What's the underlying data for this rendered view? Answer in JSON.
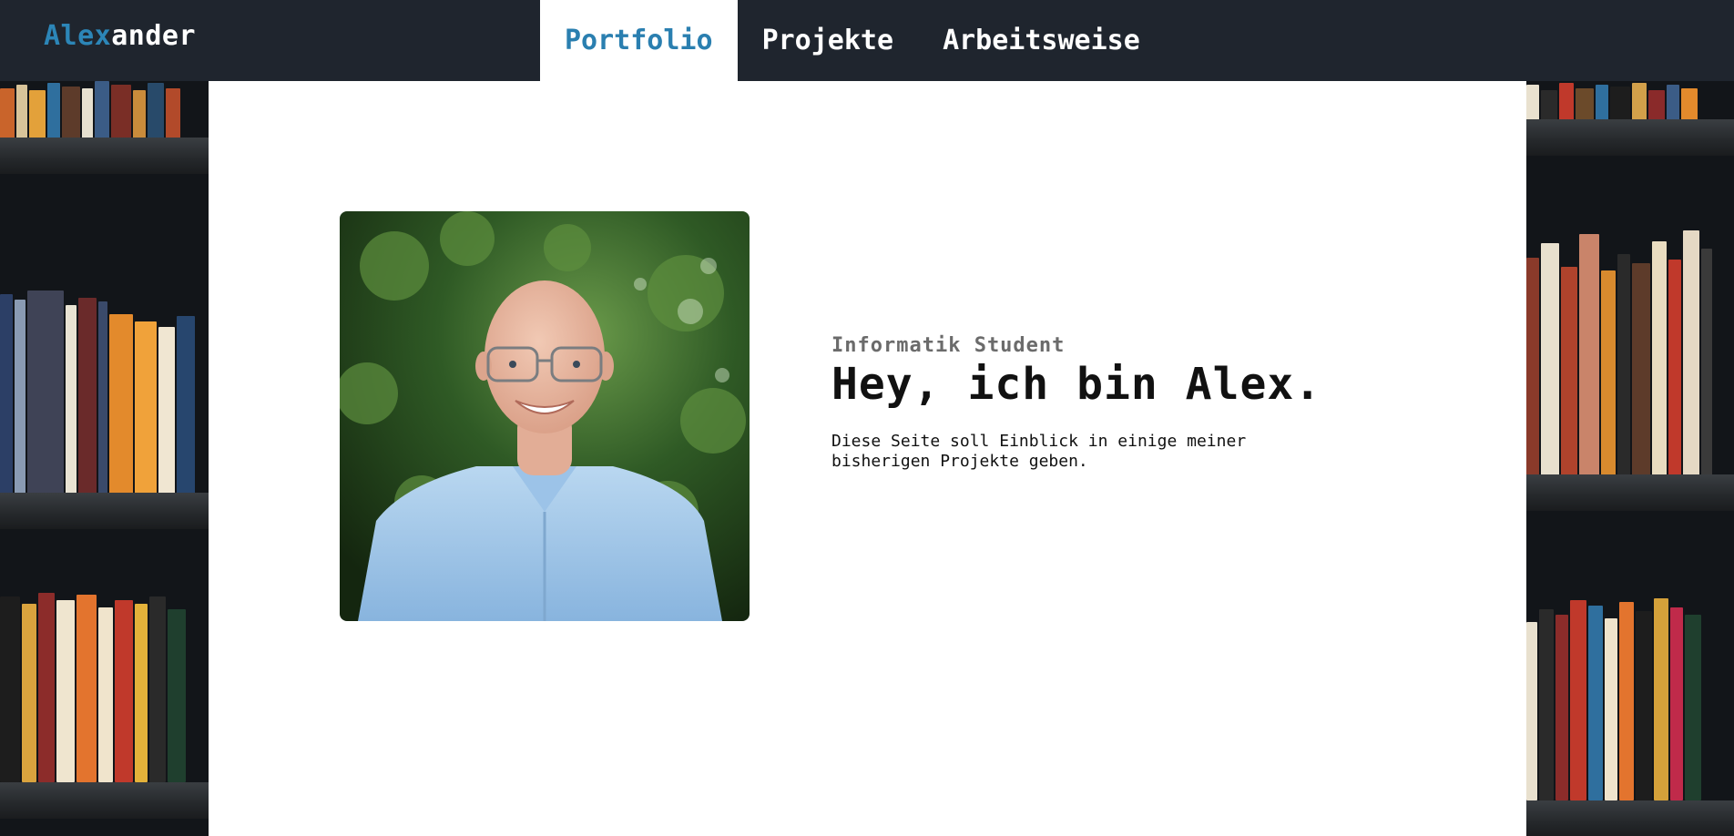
{
  "header": {
    "brand_accent": "Alex",
    "brand_rest": "ander",
    "nav": [
      {
        "label": "Portfolio",
        "active": true
      },
      {
        "label": "Projekte",
        "active": false
      },
      {
        "label": "Arbeitsweise",
        "active": false
      }
    ]
  },
  "hero": {
    "subtitle": "Informatik Student",
    "title": "Hey, ich bin Alex.",
    "text": "Diese Seite soll Einblick in einige meiner bisherigen Projekte geben."
  },
  "colors": {
    "accent": "#2c86b8",
    "topbar": "#1f252e",
    "panel": "#ffffff"
  }
}
